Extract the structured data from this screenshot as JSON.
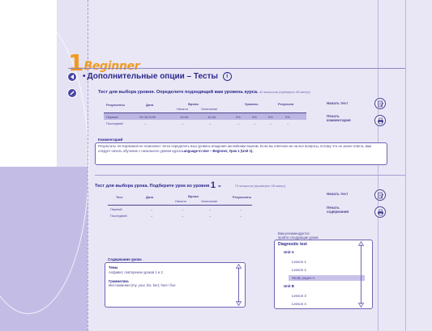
{
  "logo": {
    "number": "1",
    "word": "Beginner"
  },
  "page_title": "Дополнительные опции – Тесты",
  "sidebar_icons": [
    {
      "name": "back-arrow-icon"
    },
    {
      "name": "pencil-icon"
    }
  ],
  "test1": {
    "title": "Тест для выбора уровня. Определите подходящий вам уровень курса.",
    "note": "40 вопросов (примерно 45 минут)",
    "headers": {
      "results": "Результаты",
      "date": "Дата",
      "time": "Время",
      "time_start": "Начало",
      "time_end": "Окончание",
      "levels": "Уровень",
      "result_pct": "Результат"
    },
    "rows": [
      {
        "label": "Первый",
        "date": "25.08.2005",
        "start": "10:45",
        "end": "10:46",
        "l1": "0%",
        "l2": "0%",
        "l3": "0%",
        "total": "0%",
        "highlighted": true
      },
      {
        "label": "Последний",
        "date": "–",
        "start": "–",
        "end": "–",
        "l1": "–",
        "l2": "–",
        "l3": "–",
        "total": "–",
        "highlighted": false
      }
    ],
    "actions": [
      {
        "label": "Начать тест",
        "icon": "test-sheet-icon"
      },
      {
        "label": "Печать\nкомментария",
        "icon": "printer-icon"
      }
    ],
    "comment_label": "Комментарий",
    "comment_text": "Результаты тестирования не позволяют четко определить ваш уровень владения английским языком. Если вы ответили не на все вопросы, потому что не знали ответа, вам следует начать обучение с начального уровня курса ",
    "comment_bold": "Language In Use – Beginner, Урок 1 (Unit 1)."
  },
  "test2": {
    "title": "Тест для выбора урока. Подберите урок из уровня",
    "level_number": "1",
    "note": "75 вопросов (примерно 45 минут)",
    "headers": {
      "test": "Тест",
      "date": "Дата",
      "time": "Время",
      "time_start": "Начало",
      "time_end": "Окончание",
      "results": "Результаты"
    },
    "rows": [
      {
        "label": "Первый",
        "date": "–",
        "start": "–",
        "end": "–",
        "result": "–"
      },
      {
        "label": "Последний",
        "date": "–",
        "start": "–",
        "end": "–",
        "result": "–"
      }
    ],
    "actions": [
      {
        "label": "Начать тест",
        "icon": "test-sheet-icon"
      },
      {
        "label": "Печать\nсодержания",
        "icon": "printer-icon"
      }
    ],
    "recommend_label": "Вам рекомендуется\nпройти следующие уроки:",
    "content_label": "Содержание урока",
    "content": {
      "topics_label": "Темы",
      "topics": "Алфавит, повторение уроков 1 и 2.",
      "grammar_label": "Грамматика",
      "grammar": "Местоимения (my, your, his, her); here / live"
    },
    "tree": [
      {
        "text": "Diagnostic test",
        "level": 0,
        "highlight": false
      },
      {
        "text": "Unit A",
        "level": 1,
        "highlight": false
      },
      {
        "text": "Lesson 1",
        "level": 2,
        "highlight": false
      },
      {
        "text": "Lesson 2",
        "level": 2,
        "highlight": false
      },
      {
        "text": "Study pages A",
        "level": 2,
        "highlight": true
      },
      {
        "text": "Unit B",
        "level": 1,
        "highlight": false
      },
      {
        "text": "Lesson 3",
        "level": 2,
        "highlight": false
      },
      {
        "text": "Lesson 4",
        "level": 2,
        "highlight": false
      }
    ]
  },
  "colors": {
    "accent_orange": "#f19a1e",
    "navy": "#2e2a8c",
    "panel": "#e5e2f4",
    "panel_dark": "#c3bde6",
    "highlight_row": "#bcb6e2"
  }
}
